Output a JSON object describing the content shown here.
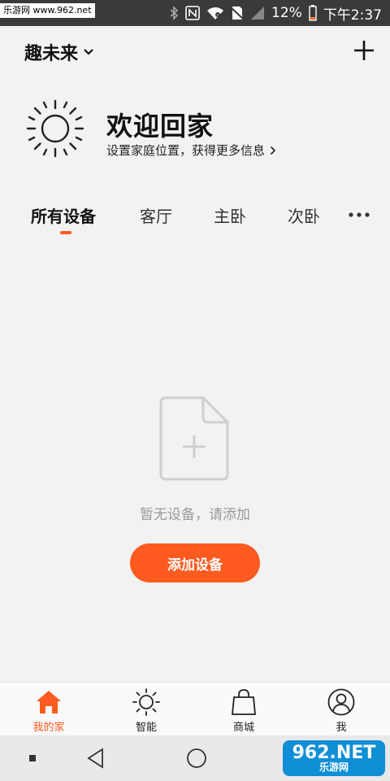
{
  "statusbar": {
    "watermark": "乐游网 www.962.net",
    "battery": "12%",
    "time": "下午2:37",
    "icons": [
      "bluetooth-icon",
      "nfc-icon",
      "wifi-icon",
      "no-sim-icon",
      "signal-icon",
      "battery-icon"
    ]
  },
  "header": {
    "home_name": "趣未来",
    "add_icon": "plus-icon"
  },
  "welcome": {
    "title": "欢迎回家",
    "subtitle": "设置家庭位置，获得更多信息",
    "icon": "sun-icon"
  },
  "tabs": [
    {
      "label": "所有设备",
      "active": true
    },
    {
      "label": "客厅",
      "active": false
    },
    {
      "label": "主卧",
      "active": false
    },
    {
      "label": "次卧",
      "active": false
    }
  ],
  "empty_state": {
    "message": "暂无设备，请添加",
    "button": "添加设备"
  },
  "bottom_nav": [
    {
      "label": "我的家",
      "icon": "home-icon",
      "active": true
    },
    {
      "label": "智能",
      "icon": "sun-icon",
      "active": false
    },
    {
      "label": "商城",
      "icon": "bag-icon",
      "active": false
    },
    {
      "label": "我",
      "icon": "user-icon",
      "active": false
    }
  ],
  "watermark_logo": {
    "big": "962.NET",
    "small": "乐游网"
  },
  "colors": {
    "accent": "#ff5a1f",
    "background": "#f2f2f2",
    "statusbar": "#3a3a3a"
  }
}
